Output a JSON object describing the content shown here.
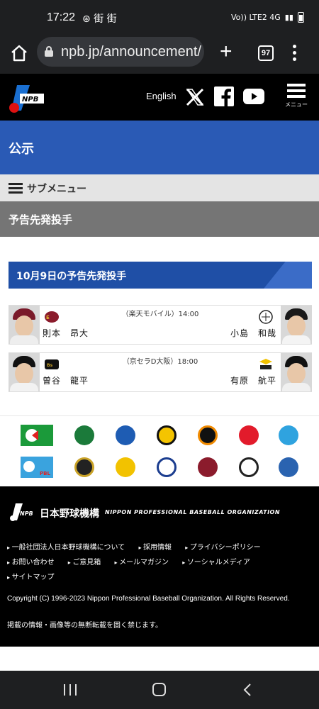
{
  "status_bar": {
    "time": "17:22",
    "notifications": "⊛ 街 街",
    "network": "Vo)) LTE2 4G"
  },
  "browser": {
    "url": "npb.jp/announcement/",
    "tab_count": "97"
  },
  "header": {
    "language_link": "English",
    "menu_label": "メニュー"
  },
  "page": {
    "title": "公示",
    "submenu_label": "サブメニュー",
    "section_title": "予告先発投手"
  },
  "schedule": {
    "date_heading": "10月9日の予告先発投手",
    "games": [
      {
        "venue_time": "（楽天モバイル）14:00",
        "home_pitcher": "則本　昂大",
        "away_pitcher": "小島　和哉",
        "home_team": "eagles",
        "away_team": "marines"
      },
      {
        "venue_time": "（京セラD大阪）18:00",
        "home_pitcher": "曽谷　龍平",
        "away_pitcher": "有原　航平",
        "home_team": "buffaloes",
        "away_team": "hawks"
      }
    ]
  },
  "teams_row1": [
    "cl-league",
    "swallows",
    "baystars",
    "tigers",
    "giants",
    "carp",
    "dragons"
  ],
  "teams_row2": [
    "pa-league",
    "buffaloes",
    "hawks",
    "lions",
    "eagles",
    "marines",
    "fighters"
  ],
  "footer": {
    "org_name_jp": "日本野球機構",
    "org_name_en": "NIPPON PROFESSIONAL BASEBALL ORGANIZATION",
    "links": [
      "一般社団法人日本野球機構について",
      "採用情報",
      "プライバシーポリシー",
      "お問い合わせ",
      "ご意見箱",
      "メールマガジン",
      "ソーシャルメディア",
      "サイトマップ"
    ],
    "copyright": "Copyright (C) 1996-2023 Nippon Professional Baseball Organization. All Rights Reserved.",
    "notice": "掲載の情報・画像等の無断転載を固く禁じます。"
  },
  "colors": {
    "title_band": "#2a5ab5",
    "date_heading": "#1f4fa6",
    "section_bar": "#757575",
    "footer": "#000000"
  }
}
